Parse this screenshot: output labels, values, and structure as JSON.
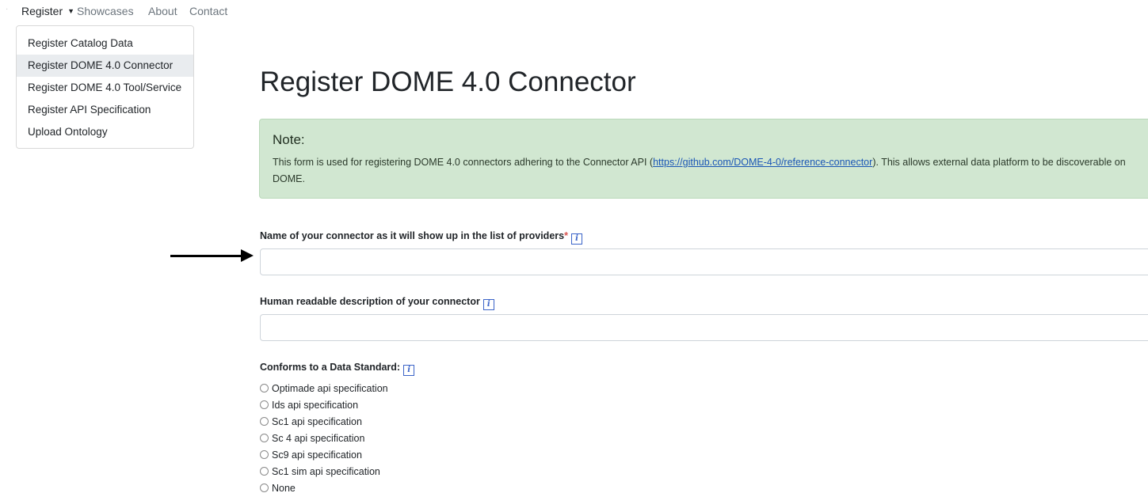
{
  "nav": {
    "bullet": "·",
    "register_label": "Register",
    "caret": "▼",
    "showcases_label": "Showcases",
    "about_label": "About",
    "contact_label": "Contact"
  },
  "dropdown": {
    "items": [
      {
        "label": "Register Catalog Data",
        "active": false
      },
      {
        "label": "Register DOME 4.0 Connector",
        "active": true
      },
      {
        "label": "Register DOME 4.0 Tool/Service",
        "active": false
      },
      {
        "label": "Register API Specification",
        "active": false
      },
      {
        "label": "Upload Ontology",
        "active": false
      }
    ]
  },
  "page": {
    "title": "Register DOME 4.0 Connector"
  },
  "note": {
    "title": "Note:",
    "text_before": "This form is used for registering DOME 4.0 connectors adhering to the Connector API (",
    "link_text": "https://github.com/DOME-4-0/reference-connector",
    "text_after": "). This allows external data platform to be discoverable on DOME.",
    "bg_color": "#d1e7d1"
  },
  "form": {
    "name_field": {
      "label": "Name of your connector as it will show up in the list of providers",
      "required_mark": "*",
      "info_icon": "i",
      "value": ""
    },
    "description_field": {
      "label": "Human readable description of your connector",
      "info_icon": "i",
      "value": ""
    },
    "standard_field": {
      "label": "Conforms to a Data Standard:",
      "info_icon": "i",
      "options": [
        "Optimade api specification",
        "Ids api specification",
        "Sc1 api specification",
        "Sc 4 api specification",
        "Sc9 api specification",
        "Sc1 sim api specification",
        "None"
      ]
    }
  },
  "icons": {
    "info": "info-icon",
    "arrow": "arrow-right-icon",
    "caret": "caret-down-icon"
  },
  "colors": {
    "required": "#d9534f",
    "info_icon": "#3b64c8",
    "link": "#1a56b5",
    "active_menu_bg": "#e9ecef"
  }
}
